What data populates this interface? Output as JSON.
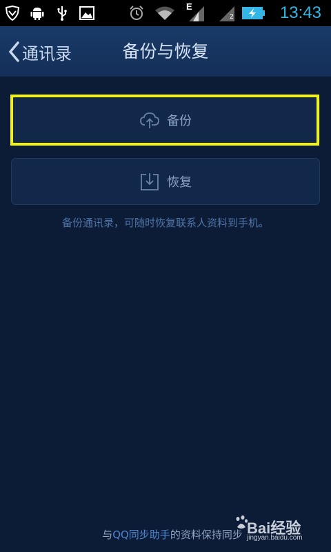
{
  "status_bar": {
    "time": "13:43",
    "icons": [
      "shield-icon",
      "android-debug-icon",
      "usb-icon",
      "image-icon",
      "alarm-icon",
      "wifi-icon",
      "signal-e-icon",
      "signal-2-icon",
      "battery-charging-icon"
    ],
    "signal_letter": "E",
    "signal_sim": "2",
    "accent_color": "#33b5e5"
  },
  "title_bar": {
    "back_label": "通讯录",
    "title": "备份与恢复"
  },
  "actions": {
    "backup_label": "备份",
    "restore_label": "恢复"
  },
  "hint": "备份通讯录，可随时恢复联系人资料到手机。",
  "footer": {
    "prefix": "与",
    "link": "QQ同步助手",
    "suffix": "的资料保持同步"
  },
  "watermark": {
    "text": "Bai经验",
    "sub": "jingyan.baidu.com"
  },
  "colors": {
    "background": "#0c1b36",
    "highlight": "#f4f10c",
    "link": "#4f86cf"
  }
}
